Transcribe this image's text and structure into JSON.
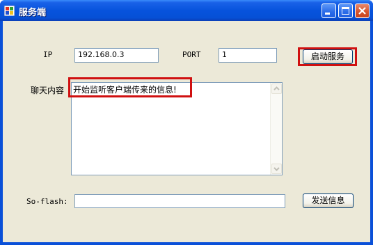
{
  "window": {
    "title": "服务端"
  },
  "form": {
    "ip_label": "IP",
    "ip_value": "192.168.0.3",
    "port_label": "PORT",
    "port_value": "1",
    "start_button": "启动服务",
    "chat_label": "聊天内容",
    "chat_content": "开始监听客户端传来的信息!",
    "send_label": "So-flash:",
    "send_input_value": "",
    "send_button": "发送信息"
  },
  "colors": {
    "highlight": "#d01010",
    "titlebar": "#0753dd",
    "face": "#ece9d8"
  }
}
